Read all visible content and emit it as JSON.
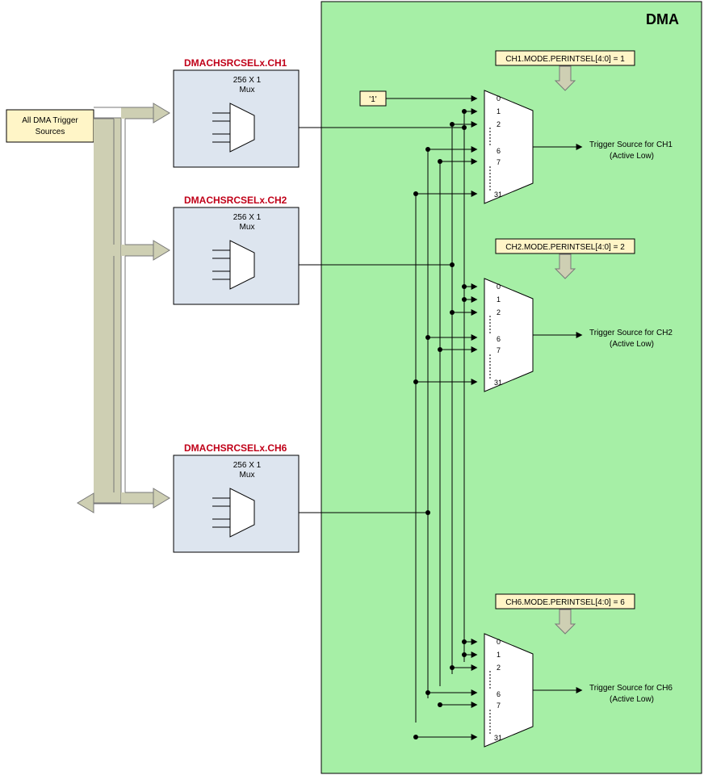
{
  "dma_title": "DMA",
  "trigger_source_label": "All DMA Trigger Sources",
  "mux_label": "256 X 1",
  "mux_sublabel": "Mux",
  "one_label": "'1'",
  "muxes": [
    {
      "name": "DMACHSRCSELx.CH1"
    },
    {
      "name": "DMACHSRCSELx.CH2"
    },
    {
      "name": "DMACHSRCSELx.CH6"
    }
  ],
  "selectors": [
    {
      "title": "CH1.MODE.PERINTSEL[4:0] = 1",
      "out1": "Trigger Source for CH1",
      "out2": "(Active Low)"
    },
    {
      "title": "CH2.MODE.PERINTSEL[4:0] = 2",
      "out1": "Trigger Source for CH2",
      "out2": "(Active Low)"
    },
    {
      "title": "CH6.MODE.PERINTSEL[4:0] = 6",
      "out1": "Trigger Source for CH6",
      "out2": "(Active Low)"
    }
  ],
  "port_labels": [
    "0",
    "1",
    "2",
    "6",
    "7",
    "31"
  ]
}
